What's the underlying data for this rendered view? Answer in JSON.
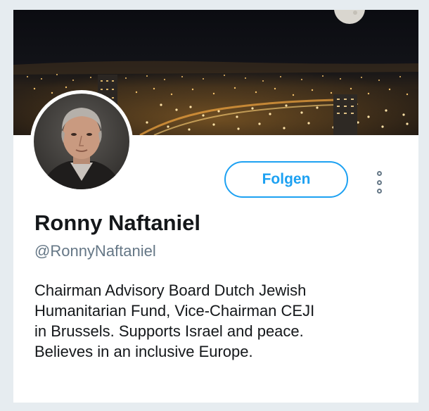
{
  "profile": {
    "name": "Ronny Naftaniel",
    "handle": "@RonnyNaftaniel",
    "bio_lines": [
      "Chairman Advisory Board Dutch Jewish",
      "Humanitarian Fund, Vice-Chairman CEJI",
      "in Brussels. Supports Israel and peace.",
      "Believes in an inclusive Europe."
    ]
  },
  "actions": {
    "follow_label": "Folgen",
    "more_icon": "more-vertical-icon"
  },
  "colors": {
    "accent": "#1da1f2",
    "text_primary": "#14171a",
    "text_secondary": "#657786",
    "page_background": "#e6ecf0"
  }
}
